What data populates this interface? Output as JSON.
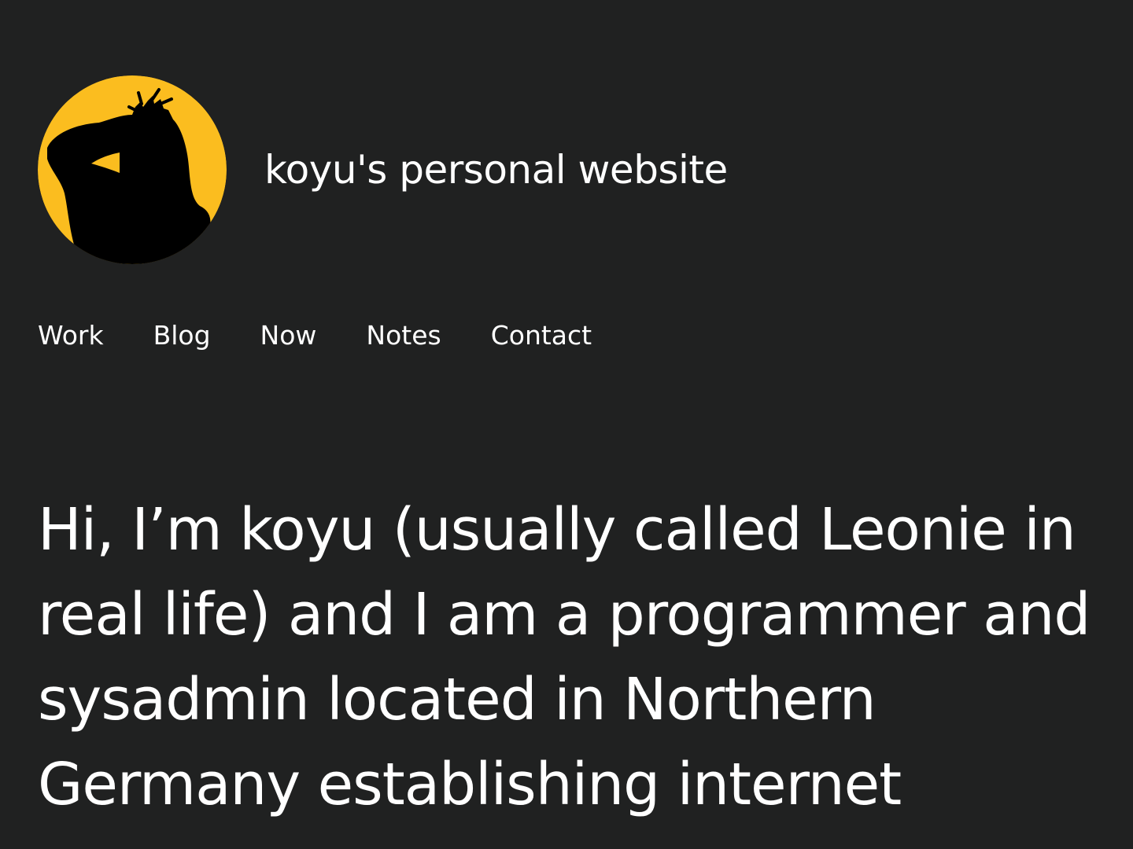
{
  "site": {
    "title": "koyu's personal website",
    "avatar_icon": "silhouette-avatar-icon",
    "accent_color": "#FBBD1F",
    "background_color": "#202121"
  },
  "nav": {
    "items": [
      {
        "label": "Work"
      },
      {
        "label": "Blog"
      },
      {
        "label": "Now"
      },
      {
        "label": "Notes"
      },
      {
        "label": "Contact"
      }
    ]
  },
  "intro": {
    "text": "Hi, I’m koyu (usually called Leonie in real life) and I am a programmer and sysadmin located in Northern Germany establishing internet"
  }
}
